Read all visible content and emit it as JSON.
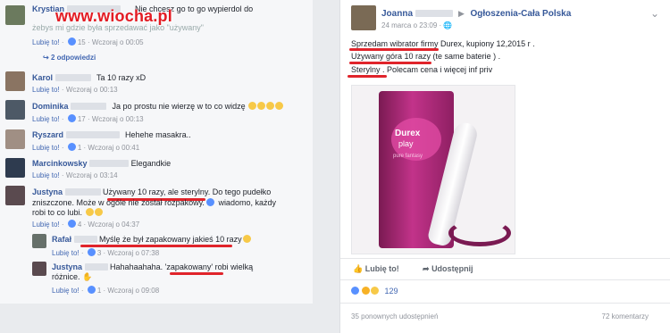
{
  "watermark": "www.wiocha.pl",
  "comments": [
    {
      "name": "Krystian",
      "text": "Nie chcesz go to go wypierdol do",
      "text2": "żebys mi gdzie była sprzedawać jako \"używany\"",
      "like": "Lubię to!",
      "count": "15",
      "time": "Wczoraj o 00:05"
    },
    {
      "replies": "2 odpowiedzi"
    },
    {
      "name": "Karol",
      "text": "Ta 10 razy xD",
      "like": "Lubię to!",
      "time": "Wczoraj o 00:13"
    },
    {
      "name": "Dominika",
      "text": "Ja po prostu nie wierzę w to co widzę",
      "like": "Lubię to!",
      "count": "17",
      "time": "Wczoraj o 00:13"
    },
    {
      "name": "Ryszard",
      "text": "Hehehe masakra..",
      "like": "Lubię to!",
      "count": "1",
      "time": "Wczoraj o 00:41"
    },
    {
      "name": "Marcinkowsky",
      "text": "Elegandkie",
      "like": "Lubię to!",
      "time": "Wczoraj o 03:14"
    },
    {
      "name": "Justyna",
      "text_hl": "Używany 10 razy, ale sterylny.",
      "text": " Do tego pudełko",
      "text2": "zniszczone. Może w ogóle nie został rozpakowy.",
      "text3": " wiadomo, każdy",
      "text4": "robi to co lubi.",
      "like": "Lubię to!",
      "count": "4",
      "time": "Wczoraj o 04:37"
    },
    {
      "name": "Rafał",
      "text_hl": "Myślę że był zapakowany jakieś 10 razy",
      "like": "Lubię to!",
      "count": "3",
      "time": "Wczoraj o 07:38"
    },
    {
      "name": "Justyna",
      "text": "Hahahaahaha. ",
      "text_hl": "'zapakowany'",
      "text2": " robi wielką",
      "text3": "różnice.",
      "like": "Lubię to!",
      "count": "1",
      "time": "Wczoraj o 09:08"
    }
  ],
  "post": {
    "author": "Joanna",
    "group": "Ogłoszenia-Cała Polska",
    "date": "24 marca o 23:09",
    "line1": "Sprzedam wibrator firmy Durex, kupiony 12,2015 r .",
    "line2_hl": "Używany góra 10 razy",
    "line2_rest": " (te same baterie ) .",
    "line3_hl": "Sterylny",
    "line3_rest": " . Polecam cena i więcej inf priv",
    "box_brand": "Durex",
    "box_sub": "play",
    "box_small": "pure fantasy",
    "like_btn": "Lubię to!",
    "share_btn": "Udostępnij",
    "reactions_count": "129",
    "shares": "35 ponownych udostępnień",
    "comments_count": "72 komentarzy"
  },
  "colors": {
    "accent": "#4267b2",
    "highlight": "#e0242b",
    "product": "#b5287d"
  }
}
